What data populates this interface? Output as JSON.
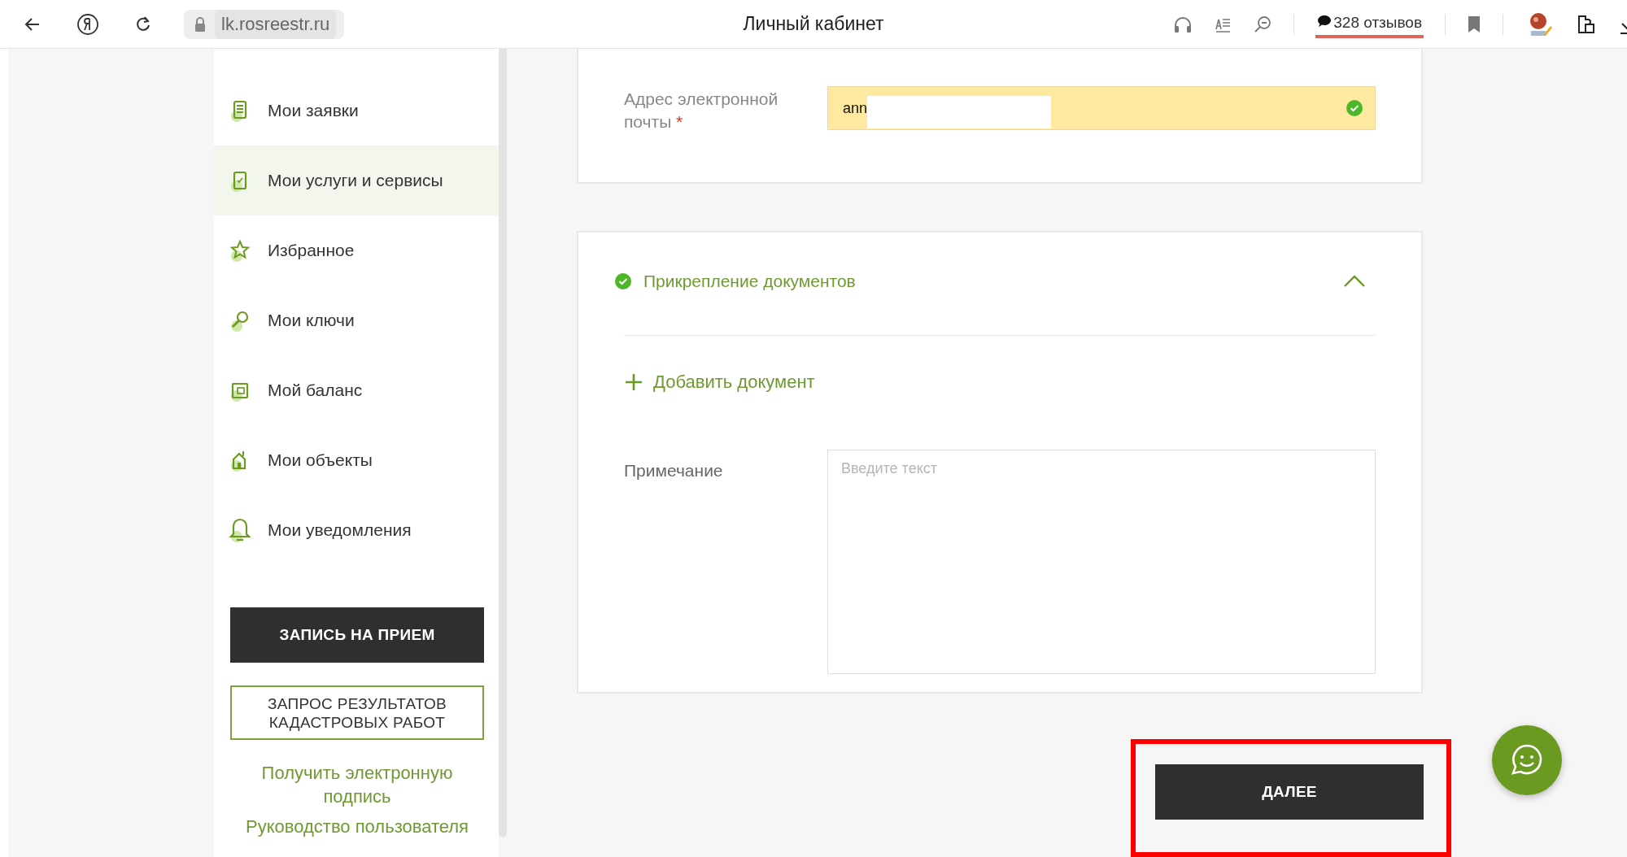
{
  "browser": {
    "address": "lk.rosreestr.ru",
    "title": "Личный кабинет",
    "reviews": "328 отзывов"
  },
  "sidebar": {
    "items": [
      {
        "label": "Мои заявки",
        "kind": "document",
        "selected": false
      },
      {
        "label": "Мои услуги и сервисы",
        "kind": "checklist",
        "selected": true
      },
      {
        "label": "Избранное",
        "kind": "star",
        "selected": false
      },
      {
        "label": "Мои ключи",
        "kind": "key",
        "selected": false
      },
      {
        "label": "Мой баланс",
        "kind": "wallet",
        "selected": false
      },
      {
        "label": "Мои объекты",
        "kind": "house",
        "selected": false
      },
      {
        "label": "Мои уведомления",
        "kind": "bell",
        "selected": false
      }
    ],
    "appointment_button": "ЗАПИСЬ НА ПРИЕМ",
    "request_button": "ЗАПРОС РЕЗУЛЬТАТОВ КАДАСТРОВЫХ РАБОТ",
    "links": [
      "Получить электронную подпись",
      "Руководство пользователя"
    ]
  },
  "email": {
    "label": "Адрес электронной почты",
    "required_mark": "*",
    "value": "ann",
    "valid": true
  },
  "attachments": {
    "title": "Прикрепление документов",
    "done": true,
    "expanded": true,
    "add_label": "Добавить документ"
  },
  "note": {
    "label": "Примечание",
    "placeholder": "Введите текст"
  },
  "next_button": {
    "label": "ДАЛЕЕ",
    "highlighted": true
  }
}
